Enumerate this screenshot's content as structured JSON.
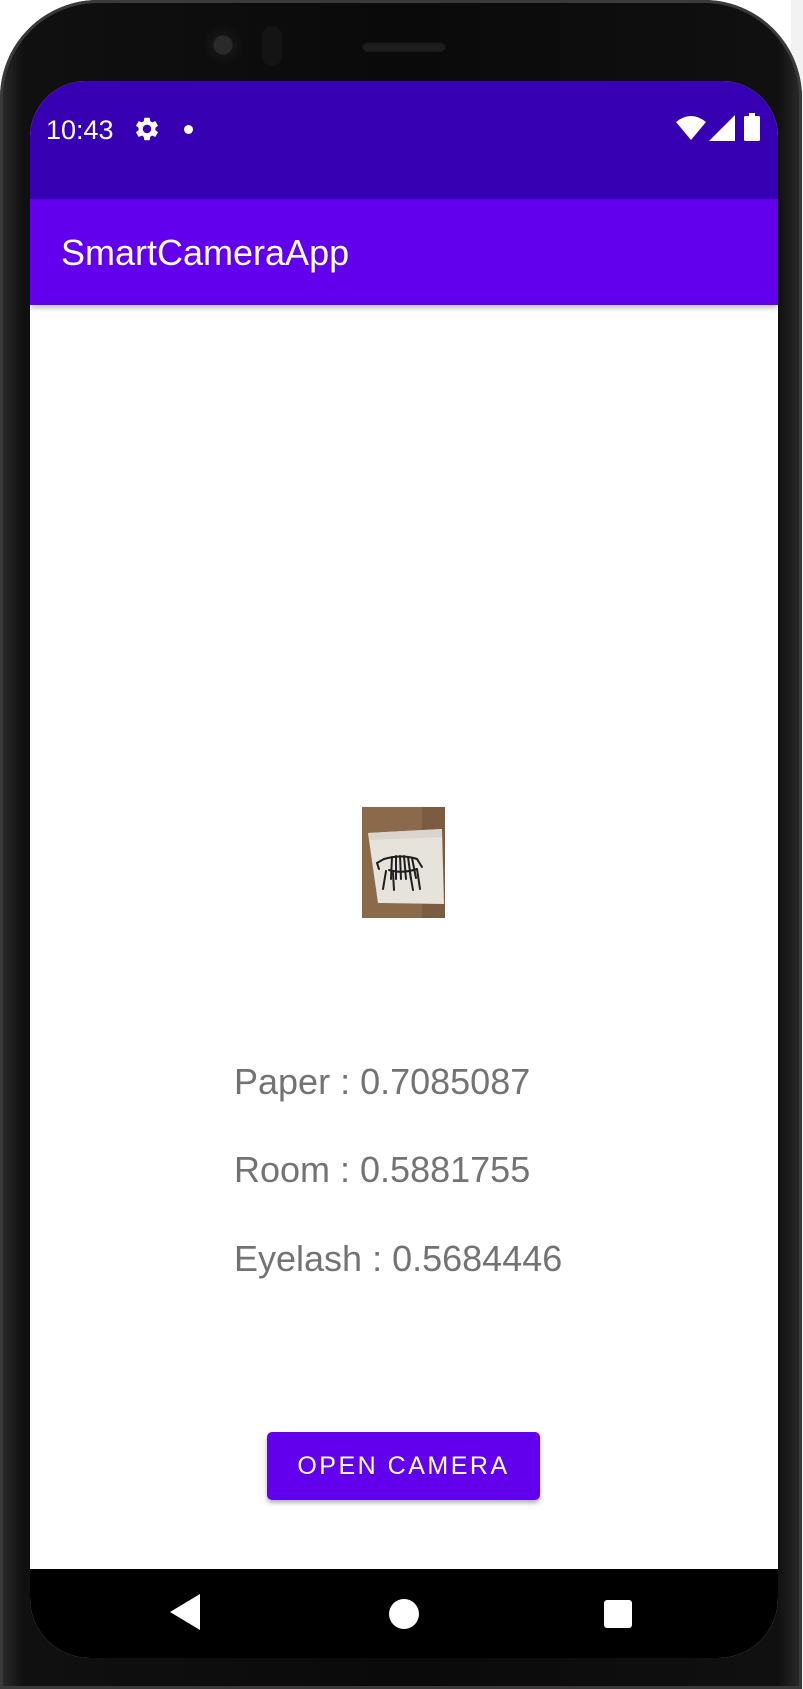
{
  "status_bar": {
    "time": "10:43",
    "icons": [
      "settings-icon",
      "notification-dot-icon",
      "wifi-icon",
      "cell-signal-icon",
      "battery-icon"
    ]
  },
  "app_bar": {
    "title": "SmartCameraApp"
  },
  "captured_image": {
    "icon": "zebra-photo-thumbnail"
  },
  "results": [
    {
      "text": "Paper : 0.7085087"
    },
    {
      "text": "Room : 0.5881755"
    },
    {
      "text": "Eyelash : 0.5684446"
    }
  ],
  "open_camera_button": {
    "label": "OPEN CAMERA"
  },
  "nav_bar": {
    "icons": [
      "back-icon",
      "home-icon",
      "recents-icon"
    ]
  },
  "colors": {
    "status_bar": "#3700b3",
    "app_bar": "#6200ee",
    "button": "#6200ee",
    "result_text": "#737373"
  }
}
